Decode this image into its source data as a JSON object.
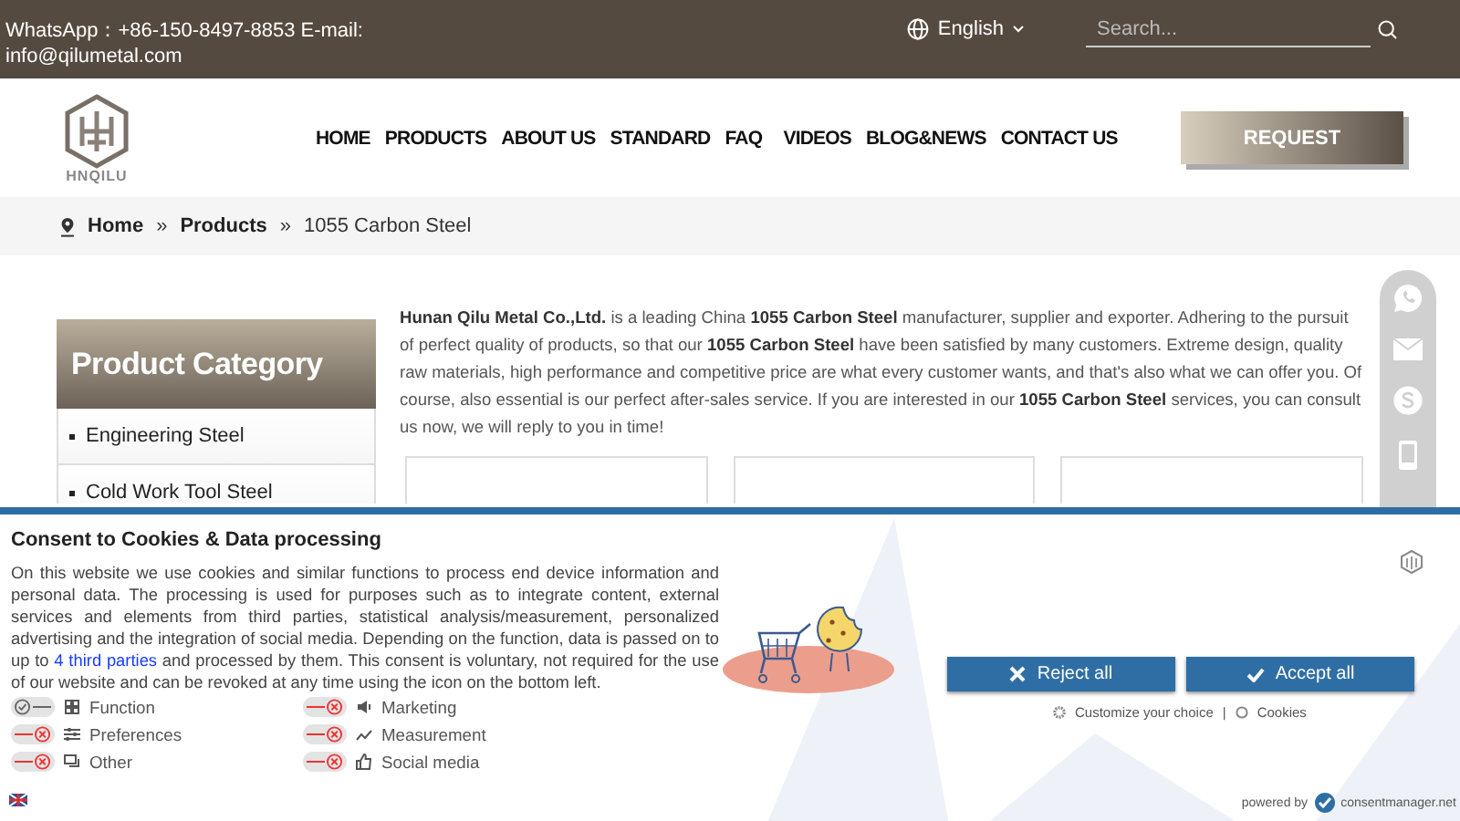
{
  "top_bar": {
    "contact": "WhatsApp：+86-150-8497-8853   E-mail: info@qilumetal.com",
    "language": "English",
    "search": {
      "placeholder": "Search..."
    }
  },
  "header": {
    "logo_text": "HNQILU",
    "nav": [
      "HOME",
      "PRODUCTS",
      "ABOUT US",
      "STANDARD",
      "FAQ",
      "VIDEOS",
      "BLOG&NEWS",
      "CONTACT US"
    ],
    "request_button": "REQUEST"
  },
  "breadcrumb": [
    {
      "label": "Home",
      "link": true
    },
    {
      "label": "Products",
      "link": true
    },
    {
      "label": "1055 Carbon Steel",
      "link": false
    }
  ],
  "breadcrumb_separator": "»",
  "sidebar": {
    "title": "Product Category",
    "items": [
      "Engineering Steel",
      "Cold Work Tool Steel"
    ]
  },
  "intro": "**Hunan Qilu Metal Co.,Ltd.** is a leading China **1055 Carbon Steel** manufacturer, supplier and exporter. Adhering to the pursuit of perfect quality of products, so that our **1055 Carbon Steel** have been satisfied by many customers. Extreme design, quality raw materials, high performance and competitive price are what every customer wants, and that's also what we can offer you. Of course, also essential is our perfect after-sales service. If you are interested in our **1055 Carbon Steel** services, you can consult us now, we will reply to you in time!",
  "consent": {
    "title": "Consent to Cookies & Data processing",
    "text_before": "On this website we use cookies and similar functions to process end device information and personal data. The processing is used for purposes such as to integrate content, external services and elements from third parties, statistical analysis/measurement, personalized advertising and the integration of social media. Depending on the function, data is passed on to up to ",
    "link": "4 third parties",
    "text_after": " and processed by them. This consent is voluntary, not required for the use of our website and can be revoked at any time using the icon on the bottom left.",
    "toggles": [
      {
        "label": "Function",
        "on": true
      },
      {
        "label": "Marketing",
        "on": false
      },
      {
        "label": "Preferences",
        "on": false
      },
      {
        "label": "Measurement",
        "on": false
      },
      {
        "label": "Other",
        "on": false
      },
      {
        "label": "Social media",
        "on": false
      }
    ],
    "reject_button": "Reject all",
    "accept_button": "Accept all",
    "customize_link": "Customize your choice",
    "separator": "|",
    "cookies_link": "Cookies",
    "powered_by": "powered by",
    "provider": "consentmanager.net"
  }
}
